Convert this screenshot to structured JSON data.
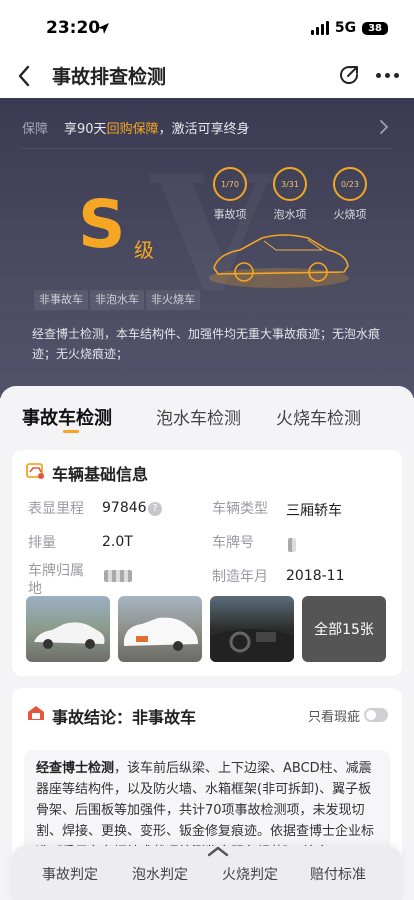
{
  "status": {
    "time": "23:20",
    "network": "5G",
    "battery": "38"
  },
  "nav": {
    "title": "事故排查检测"
  },
  "hero": {
    "guarantee_tag": "保障",
    "guarantee_pre": "享90天",
    "guarantee_highlight": "回购保障",
    "guarantee_post": "，激活可享终身",
    "grade": "S",
    "grade_suffix": "级",
    "stats": [
      {
        "value": "1/70",
        "label": "事故项"
      },
      {
        "value": "3/31",
        "label": "泡水项"
      },
      {
        "value": "0/23",
        "label": "火烧项"
      }
    ],
    "tags": [
      "非事故车",
      "非泡水车",
      "非火烧车"
    ],
    "summary": "经查博士检测，本车结构件、加强件均无重大事故痕迹；无泡水痕迹；无火烧痕迹；"
  },
  "tabs": [
    "事故车检测",
    "泡水车检测",
    "火烧车检测"
  ],
  "basic_info": {
    "title": "车辆基础信息",
    "mileage_label": "表显里程",
    "mileage_value": "97846",
    "type_label": "车辆类型",
    "type_value": "三厢轿车",
    "displacement_label": "排量",
    "displacement_value": "2.0T",
    "plate_label": "车牌号",
    "location_label": "车牌归属地",
    "date_label": "制造年月",
    "date_value": "2018-11",
    "photos_more": "全部15张"
  },
  "conclusion": {
    "title": "事故结论：非事故车",
    "toggle_label": "只看瑕疵",
    "body_bold": "经查博士检测",
    "body": "，该车前后纵梁、上下边梁、ABCD柱、减震器座等结构件，以及防火墙、水箱框架(非可拆卸)、翼子板骨架、后围板等加强件，共计70项事故检测项，未发现切割、焊接、更换、变形、钣金修复痕迹。依据查博士企业标准《乘用车车辆技术状况检测鉴定服务规范》，综合"
  },
  "bottom_nav": [
    "事故判定",
    "泡水判定",
    "火烧判定",
    "赔付标准"
  ]
}
